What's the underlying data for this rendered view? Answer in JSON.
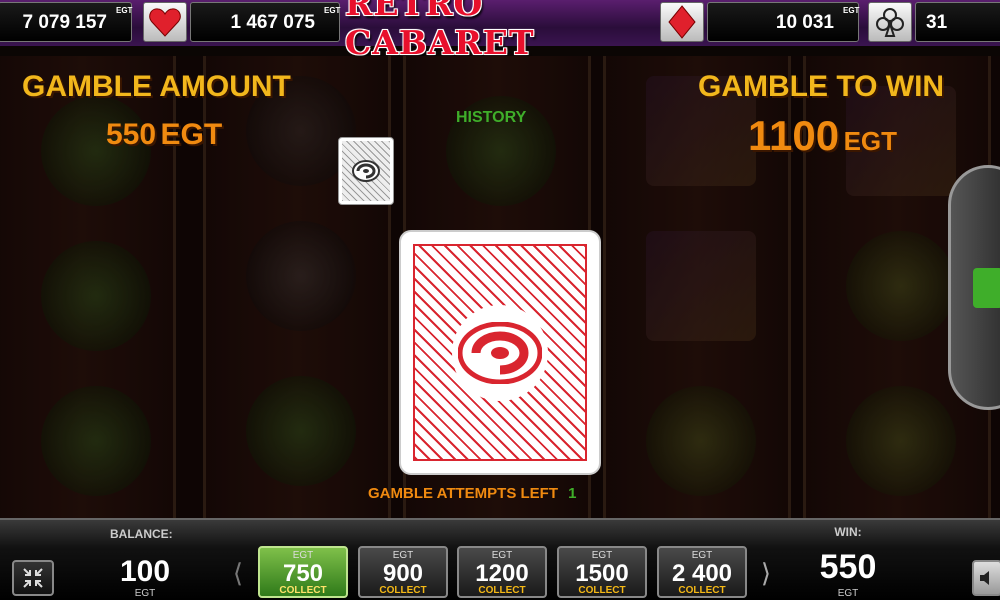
{
  "jackpots": {
    "spades": {
      "value": "7 079 157",
      "currency": "EGT",
      "suit_icon": "spade-icon"
    },
    "hearts": {
      "value": "1 467 075",
      "currency": "EGT",
      "suit_icon": "heart-icon"
    },
    "diamonds": {
      "value": "10 031",
      "currency": "EGT",
      "suit_icon": "diamond-icon"
    },
    "clubs": {
      "value": "31",
      "suit_icon": "club-icon"
    }
  },
  "logo": "RETRO CABARET",
  "gamble": {
    "amount_label": "GAMBLE AMOUNT",
    "amount_value": "550",
    "amount_currency": "EGT",
    "to_win_label": "GAMBLE TO WIN",
    "to_win_value": "1100",
    "to_win_currency": "EGT",
    "history_label": "HISTORY",
    "attempts_label": "GAMBLE ATTEMPTS LEFT",
    "attempts_value": "1"
  },
  "bottom": {
    "balance_label": "BALANCE:",
    "balance_value": "100",
    "balance_currency": "EGT",
    "win_label": "WIN:",
    "win_value": "550",
    "win_currency": "EGT",
    "bets": [
      {
        "currency": "EGT",
        "value": "750",
        "action": "COLLECT",
        "active": true
      },
      {
        "currency": "EGT",
        "value": "900",
        "action": "COLLECT"
      },
      {
        "currency": "EGT",
        "value": "1200",
        "action": "COLLECT"
      },
      {
        "currency": "EGT",
        "value": "1500",
        "action": "COLLECT"
      },
      {
        "currency": "EGT",
        "value": "2 400",
        "action": "COLLECT"
      }
    ]
  },
  "colors": {
    "accent_gold": "#f2b71c",
    "accent_orange": "#f08a10",
    "card_red": "#d9252f",
    "history_green": "#3fae2a",
    "active_bet_green": "#5aa332"
  }
}
